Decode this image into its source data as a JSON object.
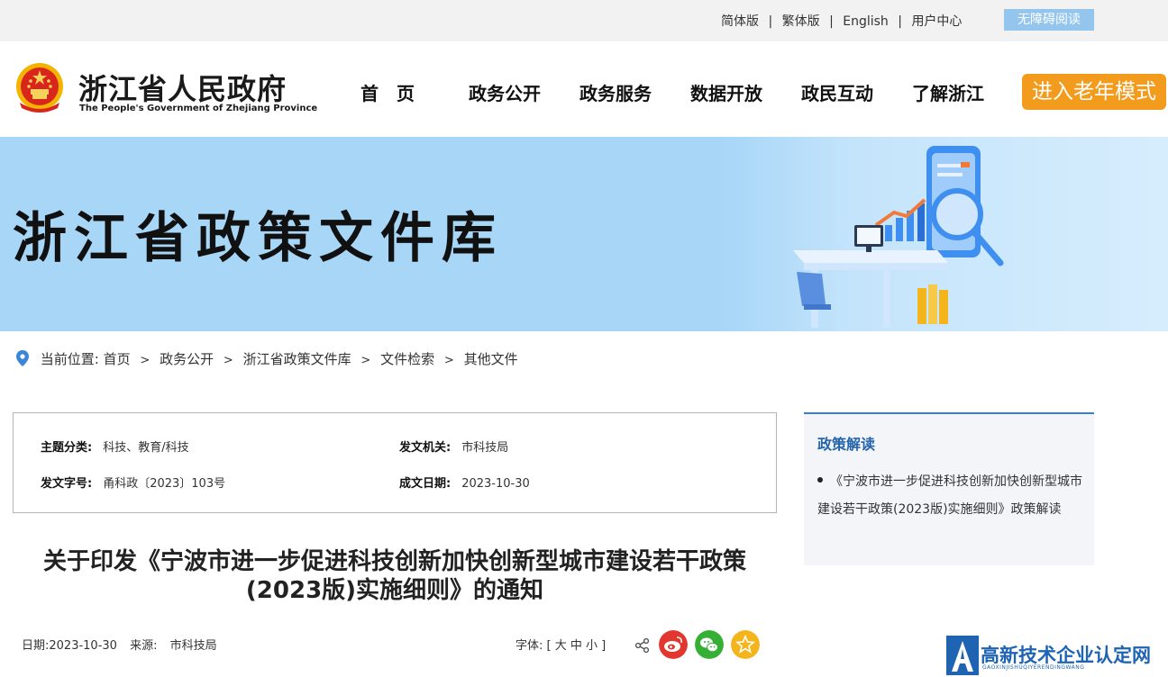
{
  "topbar": {
    "links": [
      "简体版",
      "繁体版",
      "English",
      "用户中心"
    ],
    "separator": "|",
    "accessibility": "无障碍阅读"
  },
  "header": {
    "site_name": "浙江省人民政府",
    "site_name_en": "The People's Government of Zhejiang Province",
    "emblem_icon": "national-emblem-icon",
    "nav": [
      "首　页",
      "政务公开",
      "政务服务",
      "数据开放",
      "政民互动",
      "了解浙江"
    ],
    "elder_mode": "进入老年模式"
  },
  "banner": {
    "title": "浙江省政策文件库"
  },
  "breadcrumb": {
    "prefix": "当前位置:",
    "items": [
      "首页",
      "政务公开",
      "浙江省政策文件库",
      "文件检索",
      "其他文件"
    ],
    "separator": ">"
  },
  "meta": {
    "topic_label": "主题分类:",
    "topic": "科技、教育/科技",
    "issuer_label": "发文机关:",
    "issuer": "市科技局",
    "doc_no_label": "发文字号:",
    "doc_no": "甬科政〔2023〕103号",
    "date_label": "成文日期:",
    "date": "2023-10-30"
  },
  "article": {
    "title_line1": "关于印发《宁波市进一步促进科技创新加快创新型城市建设若干政策",
    "title_line2": "(2023版)实施细则》的通知",
    "date_label": "日期:",
    "date": "2023-10-30",
    "source_label": "来源:",
    "source": "市科技局",
    "font_label": "字体:",
    "font_sizes": "[ 大 中 小 ]"
  },
  "sidebar": {
    "title": "政策解读",
    "item": "《宁波市进一步促进科技创新加快创新型城市建设若干政策(2023版)实施细则》政策解读"
  },
  "watermark": {
    "cn": "高新技术企业认定网",
    "en": "GAOXINJISHUQIYERENDINGWANG"
  },
  "colors": {
    "topbar_bg": "#f2f2f2",
    "accessibility_bg": "#94c5ec",
    "elder_bg": "#f29b1c",
    "banner_bg": "#a7d6f7",
    "sidebar_title": "#2565ac",
    "weibo": "#e3362e",
    "wechat": "#35b035",
    "favorite": "#f3b51b"
  }
}
